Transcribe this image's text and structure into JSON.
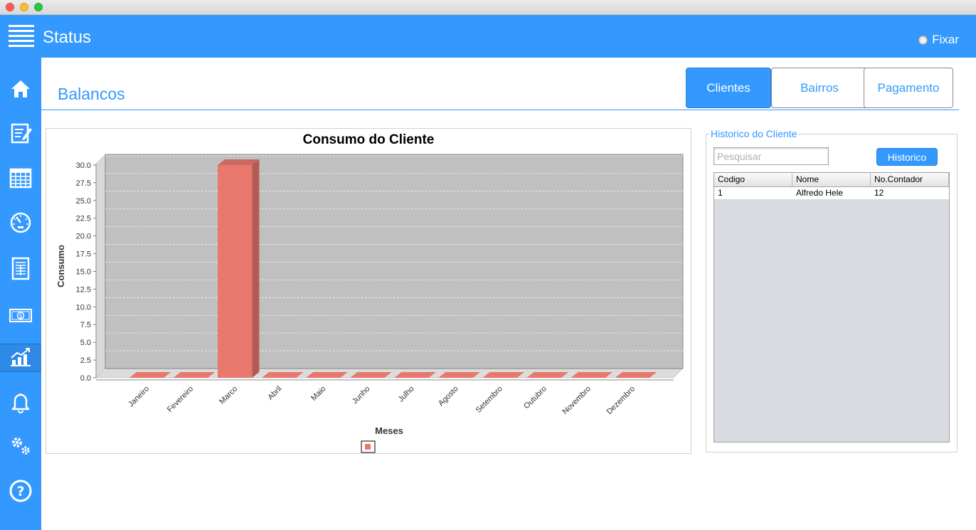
{
  "header": {
    "title": "Status",
    "fixar_label": "Fixar"
  },
  "sidebar": {
    "items": [
      {
        "icon": "home-icon"
      },
      {
        "icon": "edit-document-icon"
      },
      {
        "icon": "calendar-icon"
      },
      {
        "icon": "gauge-icon"
      },
      {
        "icon": "invoice-icon"
      },
      {
        "icon": "money-icon"
      },
      {
        "icon": "chart-icon",
        "active": true
      },
      {
        "icon": "bell-icon"
      },
      {
        "icon": "gears-icon"
      },
      {
        "icon": "help-icon"
      }
    ]
  },
  "page": {
    "title": "Balancos"
  },
  "tabs": {
    "clientes": "Clientes",
    "bairros": "Bairros",
    "pagamento": "Pagamento",
    "active": "Clientes"
  },
  "historico": {
    "legend": "Historico do Cliente",
    "search_placeholder": "Pesquisar",
    "button_label": "Historico",
    "columns": [
      "Codigo",
      "Nome",
      "No.Contador"
    ],
    "rows": [
      [
        "1",
        "Alfredo Hele",
        "12"
      ]
    ]
  },
  "chart_data": {
    "type": "bar",
    "title": "Consumo do Cliente",
    "xlabel": "Meses",
    "ylabel": "Consumo",
    "categories": [
      "Janeiro",
      "Fevereiro",
      "Marco",
      "Abril",
      "Maio",
      "Junho",
      "Julho",
      "Agosto",
      "Setembro",
      "Outubro",
      "Novembro",
      "Dezembro"
    ],
    "values": [
      0,
      0,
      30,
      0,
      0,
      0,
      0,
      0,
      0,
      0,
      0,
      0
    ],
    "ylim": [
      0,
      31.5
    ],
    "yticks": [
      "0.0",
      "2.5",
      "5.0",
      "7.5",
      "10.0",
      "12.5",
      "15.0",
      "17.5",
      "20.0",
      "22.5",
      "25.0",
      "27.5",
      "30.0"
    ],
    "bar_color": "#e8776c",
    "plot_background": "#c0c0c0",
    "grid": true,
    "legend": "bottom"
  },
  "colors": {
    "accent": "#3399ff"
  }
}
